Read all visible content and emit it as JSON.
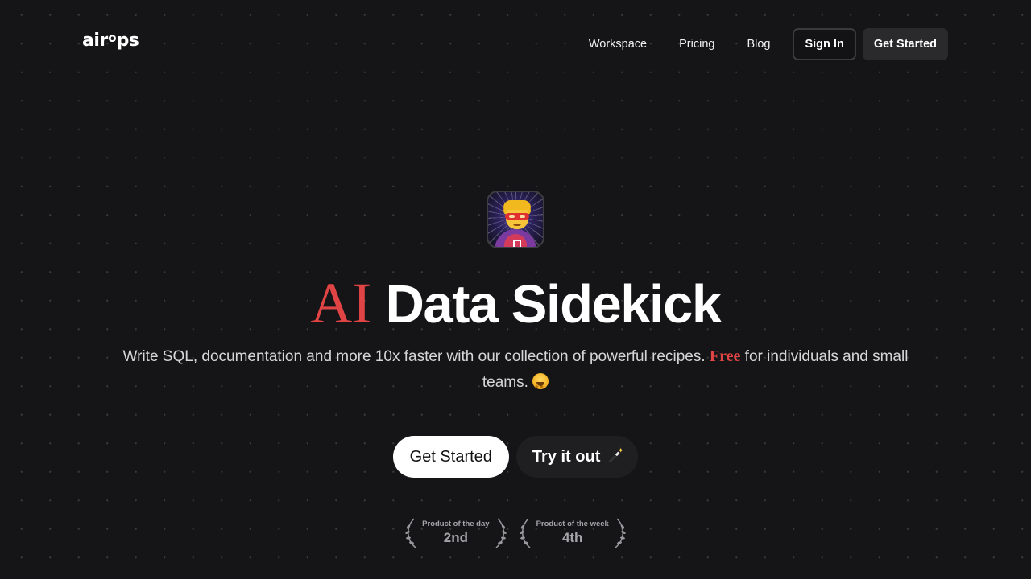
{
  "nav": {
    "logo": {
      "prefix": "air",
      "o": "o",
      "suffix": "ps"
    },
    "links": [
      {
        "label": "Workspace"
      },
      {
        "label": "Pricing"
      },
      {
        "label": "Blog"
      }
    ],
    "sign_in_label": "Sign In",
    "get_started_label": "Get Started"
  },
  "hero": {
    "icon": "superhero-emoji-icon",
    "headline_accent": "AI",
    "headline_rest": "Data Sidekick",
    "subtitle_part1": "Write SQL, documentation and more 10x faster with our collection of powerful recipes.",
    "subtitle_free": "Free",
    "subtitle_part2": "for individuals and small teams.",
    "subtitle_emoji": "star-struck-emoji-icon",
    "primary_cta": "Get Started",
    "secondary_cta": "Try it out",
    "secondary_cta_icon": "magic-wand-icon"
  },
  "badges": [
    {
      "label": "Product of the day",
      "rank": "2nd"
    },
    {
      "label": "Product of the week",
      "rank": "4th"
    }
  ],
  "colors": {
    "background": "#151517",
    "accent_red": "#e04444",
    "text_primary": "#ffffff",
    "text_secondary": "#d6d6d8"
  }
}
